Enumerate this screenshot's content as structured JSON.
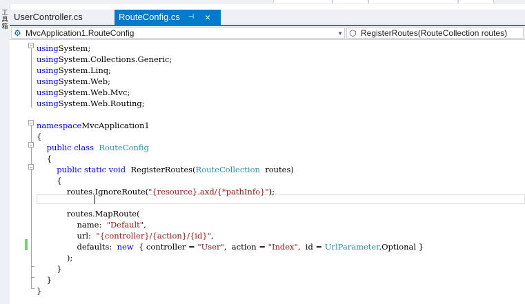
{
  "toolbox": {
    "label": "工具箱"
  },
  "tabs": [
    {
      "label": "UserController.cs",
      "active": false
    },
    {
      "label": "RouteConfig.cs",
      "active": true,
      "pin_glyph": "⊣",
      "close_glyph": "×"
    }
  ],
  "navbar": {
    "type_selector": {
      "value": "MvcApplication1.RouteConfig",
      "icon": "class-icon"
    },
    "member_selector": {
      "value": "RegisterRoutes(RouteCollection routes)",
      "icon": "method-icon"
    }
  },
  "code_lines": [
    [
      [
        "kw",
        "using"
      ],
      [
        "",
        "System;"
      ]
    ],
    [
      [
        "kw",
        "using"
      ],
      [
        "",
        "System.Collections.Generic;"
      ]
    ],
    [
      [
        "kw",
        "using"
      ],
      [
        "",
        "System.Linq;"
      ]
    ],
    [
      [
        "kw",
        "using"
      ],
      [
        "",
        "System.Web;"
      ]
    ],
    [
      [
        "kw",
        "using"
      ],
      [
        "",
        "System.Web.Mvc;"
      ]
    ],
    [
      [
        "kw",
        "using"
      ],
      [
        "",
        "System.Web.Routing;"
      ]
    ],
    [],
    [
      [
        "kw",
        "namespace"
      ],
      [
        "",
        "MvcApplication1"
      ]
    ],
    [
      [
        "",
        "{"
      ]
    ],
    [
      [
        "",
        "    "
      ],
      [
        "kw",
        "public class"
      ],
      [
        "",
        "  "
      ],
      [
        "ty",
        "RouteConfig"
      ]
    ],
    [
      [
        "",
        "    {"
      ]
    ],
    [
      [
        "",
        "        "
      ],
      [
        "kw",
        "public static void"
      ],
      [
        "",
        "  RegisterRoutes("
      ],
      [
        "ty",
        "RouteCollection"
      ],
      [
        "",
        "  routes)"
      ]
    ],
    [
      [
        "",
        "        {"
      ]
    ],
    [
      [
        "",
        "            routes.IgnoreRoute("
      ],
      [
        "st",
        "\"{resource}.axd/{*pathInfo}\""
      ],
      [
        "",
        ");"
      ]
    ],
    [],
    [
      [
        "",
        "            routes.MapRoute("
      ]
    ],
    [
      [
        "",
        "                name:  "
      ],
      [
        "st",
        "\"Default\""
      ],
      [
        "",
        ","
      ]
    ],
    [
      [
        "",
        "                url:  "
      ],
      [
        "st",
        "\"{controller}/{action}/{id}\""
      ],
      [
        "",
        ","
      ]
    ],
    [
      [
        "",
        "                defaults:  "
      ],
      [
        "kw",
        "new"
      ],
      [
        "",
        "  { controller = "
      ],
      [
        "st",
        "\"User\""
      ],
      [
        "",
        ",  action = "
      ],
      [
        "st",
        "\"Index\""
      ],
      [
        "",
        ",  id = "
      ],
      [
        "ty",
        "UrlParameter"
      ],
      [
        "",
        ".Optional }"
      ]
    ],
    [
      [
        "",
        "            );"
      ]
    ],
    [
      [
        "",
        "        }"
      ]
    ],
    [
      [
        "",
        "    }"
      ]
    ],
    [
      [
        "",
        "}"
      ]
    ]
  ]
}
